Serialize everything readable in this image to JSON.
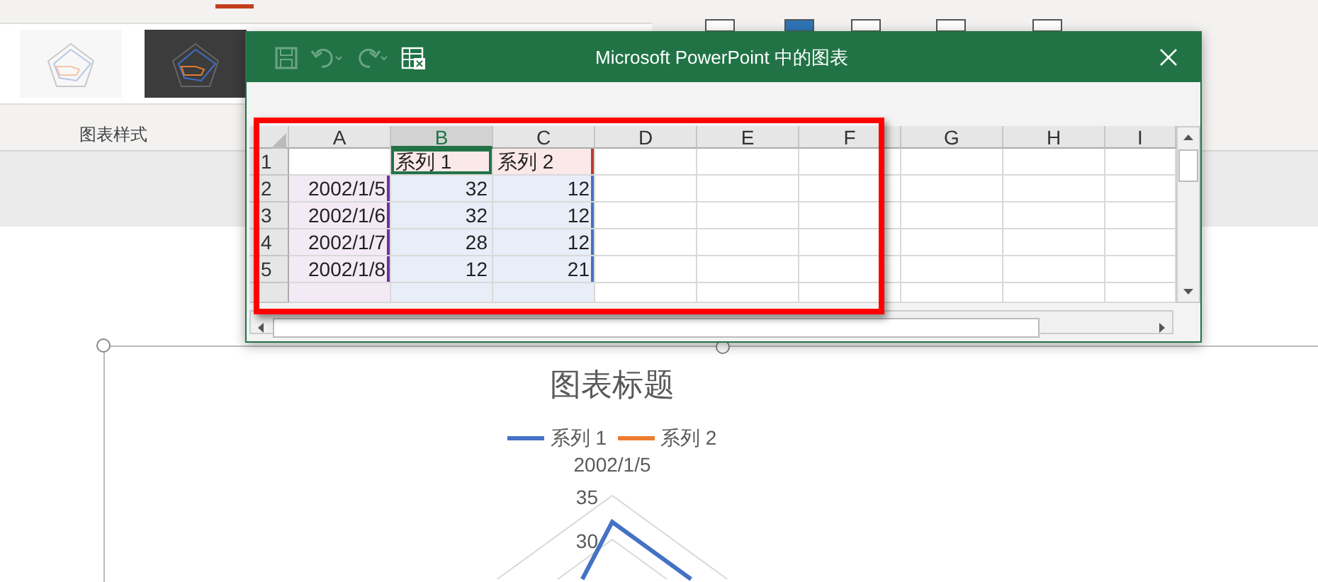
{
  "ribbon": {
    "thumbnails": [
      {
        "kind": "light",
        "selected": false
      },
      {
        "kind": "dark",
        "selected": false
      }
    ],
    "group_label": "图表样式"
  },
  "excel_window": {
    "title": "Microsoft PowerPoint 中的图表",
    "columns": [
      {
        "label": "A",
        "selected": false
      },
      {
        "label": "B",
        "selected": true
      },
      {
        "label": "C",
        "selected": false
      },
      {
        "label": "D",
        "selected": false
      },
      {
        "label": "E",
        "selected": false
      },
      {
        "label": "F",
        "selected": false
      },
      {
        "label": "G",
        "selected": false
      },
      {
        "label": "H",
        "selected": false
      },
      {
        "label": "I",
        "selected": false
      }
    ],
    "header_row": {
      "number": "1",
      "series": [
        "系列 1",
        "系列 2"
      ]
    },
    "rows": [
      {
        "number": "2",
        "date": "2002/1/5",
        "values": [
          "32",
          "12"
        ]
      },
      {
        "number": "3",
        "date": "2002/1/6",
        "values": [
          "32",
          "12"
        ]
      },
      {
        "number": "4",
        "date": "2002/1/7",
        "values": [
          "28",
          "12"
        ]
      },
      {
        "number": "5",
        "date": "2002/1/8",
        "values": [
          "12",
          "21"
        ]
      }
    ]
  },
  "chart": {
    "title": "图表标题",
    "legend": [
      {
        "name": "系列 1",
        "color": "#4472c4"
      },
      {
        "name": "系列 2",
        "color": "#ed7d31"
      }
    ],
    "axis_label": "2002/1/5",
    "tick_labels": [
      "35",
      "30"
    ]
  }
}
